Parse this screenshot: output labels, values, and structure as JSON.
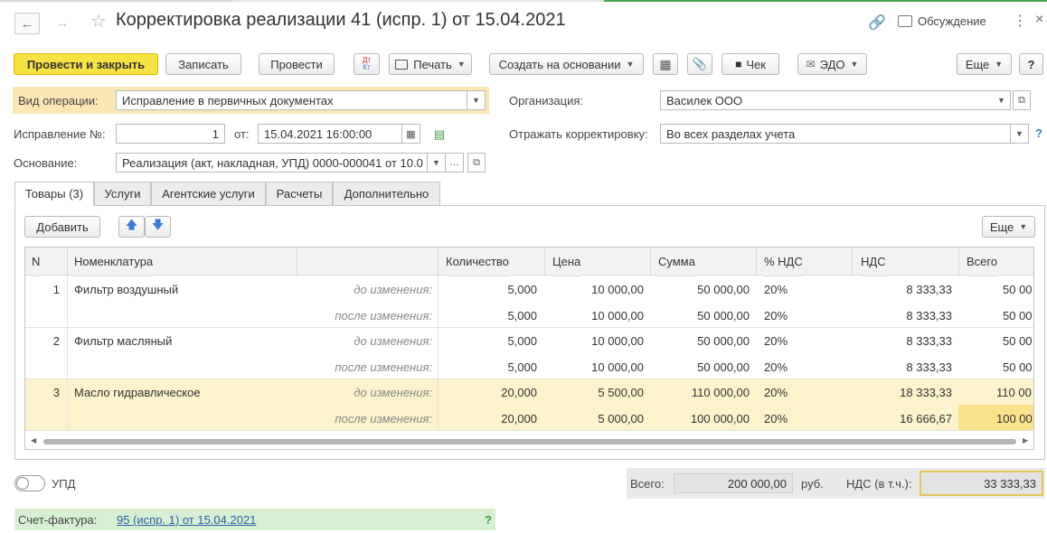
{
  "window": {
    "title": "Корректировка реализации 41 (испр. 1) от 15.04.2021",
    "discussion_label": "Обсуждение"
  },
  "toolbar": {
    "post_close": "Провести и закрыть",
    "save": "Записать",
    "post": "Провести",
    "dtkt_top": "Дт",
    "dtkt_bottom": "Кт",
    "print": "Печать",
    "create_based": "Создать на основании",
    "check": "Чек",
    "edo": "ЭДО",
    "more": "Еще",
    "help": "?"
  },
  "form": {
    "op_type_label": "Вид операции:",
    "op_type_value": "Исправление в первичных документах",
    "org_label": "Организация:",
    "org_value": "Василек ООО",
    "fix_no_label": "Исправление №:",
    "fix_no_value": "1",
    "from_label": "от:",
    "date_value": "15.04.2021 16:00:00",
    "reflect_label": "Отражать корректировку:",
    "reflect_value": "Во всех разделах учета",
    "basis_label": "Основание:",
    "basis_value": "Реализация (акт, накладная, УПД) 0000-000041 от 10.0",
    "help_q": "?"
  },
  "tabs": [
    "Товары (3)",
    "Услуги",
    "Агентские услуги",
    "Расчеты",
    "Дополнительно"
  ],
  "grid_toolbar": {
    "add": "Добавить",
    "more": "Еще"
  },
  "table": {
    "headers": [
      "N",
      "Номенклатура",
      "",
      "Количество",
      "Цена",
      "Сумма",
      "% НДС",
      "НДС",
      "Всего"
    ],
    "rows": [
      {
        "n": "1",
        "name": "Фильтр воздушный",
        "state": "до изменения:",
        "qty": "5,000",
        "price": "10 000,00",
        "sum": "50 000,00",
        "vat_rate": "20%",
        "vat": "8 333,33",
        "total": "50 00"
      },
      {
        "n": "",
        "name": "",
        "state": "после изменения:",
        "qty": "5,000",
        "price": "10 000,00",
        "sum": "50 000,00",
        "vat_rate": "20%",
        "vat": "8 333,33",
        "total": "50 00"
      },
      {
        "n": "2",
        "name": "Фильтр масляный",
        "state": "до изменения:",
        "qty": "5,000",
        "price": "10 000,00",
        "sum": "50 000,00",
        "vat_rate": "20%",
        "vat": "8 333,33",
        "total": "50 00"
      },
      {
        "n": "",
        "name": "",
        "state": "после изменения:",
        "qty": "5,000",
        "price": "10 000,00",
        "sum": "50 000,00",
        "vat_rate": "20%",
        "vat": "8 333,33",
        "total": "50 00"
      },
      {
        "n": "3",
        "name": "Масло гидравлическое",
        "state": "до изменения:",
        "qty": "20,000",
        "price": "5 500,00",
        "sum": "110 000,00",
        "vat_rate": "20%",
        "vat": "18 333,33",
        "total": "110 00"
      },
      {
        "n": "",
        "name": "",
        "state": "после изменения:",
        "qty": "20,000",
        "price": "5 000,00",
        "sum": "100 000,00",
        "vat_rate": "20%",
        "vat": "16 666,67",
        "total": "100 00"
      }
    ]
  },
  "footer": {
    "upd_label": "УПД",
    "total_label": "Всего:",
    "total_value": "200 000,00",
    "currency": "руб.",
    "vat_label": "НДС (в т.ч.):",
    "vat_value": "33 333,33",
    "invoice_label": "Счет-фактура:",
    "invoice_link": "95 (испр. 1) от 15.04.2021",
    "invoice_help": "?"
  },
  "colors": {
    "primary_button": "#f7e244",
    "selected_row": "#fcf3cc",
    "invoice_bar": "#d9efd3",
    "highlight_cell": "#f9e38a"
  }
}
